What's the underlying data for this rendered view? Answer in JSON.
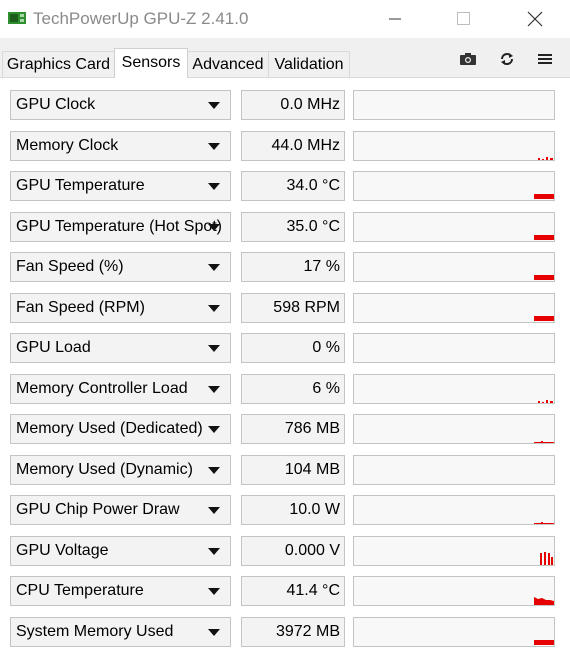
{
  "window": {
    "title": "TechPowerUp GPU-Z 2.41.0"
  },
  "tabs": [
    {
      "label": "Graphics Card"
    },
    {
      "label": "Sensors"
    },
    {
      "label": "Advanced"
    },
    {
      "label": "Validation"
    }
  ],
  "active_tab": "Sensors",
  "toolbar": {
    "icons": [
      "camera-icon",
      "refresh-icon",
      "menu-icon"
    ]
  },
  "colors": {
    "graph_line": "#e60000",
    "field_bg": "#f3f3f3",
    "border": "#c4c4c4"
  },
  "sensors": [
    {
      "name": "GPU Clock",
      "value": "0.0 MHz",
      "graph": "none"
    },
    {
      "name": "Memory Clock",
      "value": "44.0 MHz",
      "graph": "ticks"
    },
    {
      "name": "GPU Temperature",
      "value": "34.0 °C",
      "graph": "bar"
    },
    {
      "name": "GPU Temperature (Hot Spot)",
      "value": "35.0 °C",
      "graph": "bar"
    },
    {
      "name": "Fan Speed (%)",
      "value": "17 %",
      "graph": "bar"
    },
    {
      "name": "Fan Speed (RPM)",
      "value": "598 RPM",
      "graph": "bar"
    },
    {
      "name": "GPU Load",
      "value": "0 %",
      "graph": "none"
    },
    {
      "name": "Memory Controller Load",
      "value": "6 %",
      "graph": "ticks"
    },
    {
      "name": "Memory Used (Dedicated)",
      "value": "786 MB",
      "graph": "line"
    },
    {
      "name": "Memory Used (Dynamic)",
      "value": "104 MB",
      "graph": "none"
    },
    {
      "name": "GPU Chip Power Draw",
      "value": "10.0 W",
      "graph": "line"
    },
    {
      "name": "GPU Voltage",
      "value": "0.000 V",
      "graph": "spikes"
    },
    {
      "name": "CPU Temperature",
      "value": "41.4 °C",
      "graph": "area"
    },
    {
      "name": "System Memory Used",
      "value": "3972 MB",
      "graph": "bar"
    }
  ]
}
